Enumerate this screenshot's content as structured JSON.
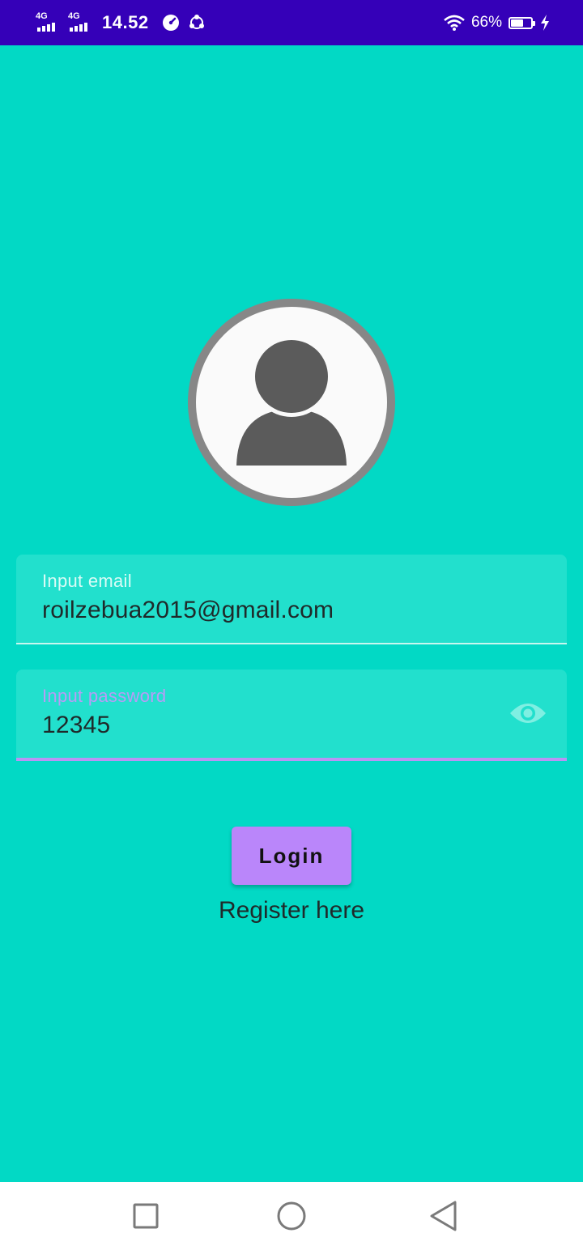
{
  "status_bar": {
    "network_1": "4G",
    "network_2": "4G",
    "time": "14.52",
    "battery_percent": "66%",
    "battery_level": 0.66,
    "icons": [
      "signal-icon",
      "signal-icon",
      "speedometer-icon",
      "sync-icon",
      "wifi-icon",
      "battery-icon",
      "charging-icon"
    ]
  },
  "avatar": {
    "icon": "user-icon"
  },
  "email_field": {
    "label": "Input email",
    "value": "roilzebua2015@gmail.com"
  },
  "password_field": {
    "label": "Input password",
    "value": "12345",
    "toggle_icon": "eye-icon"
  },
  "login_button": {
    "label": "Login"
  },
  "register_link": {
    "label": "Register here"
  },
  "nav_bar": {
    "items": [
      "recents-icon",
      "home-icon",
      "back-icon"
    ]
  },
  "colors": {
    "status_bar": "#3500B8",
    "background": "#02D9C5",
    "field_bg": "#22E0CD",
    "accent": "#BA86FA",
    "avatar_border": "#878787",
    "avatar_figure": "#5B5B5B"
  }
}
